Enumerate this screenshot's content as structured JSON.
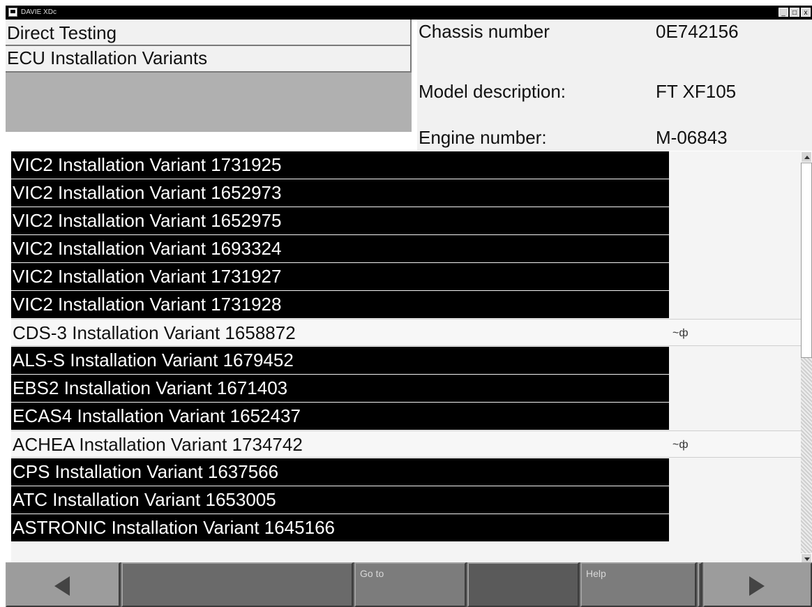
{
  "window": {
    "title": "DAVIE XDc",
    "minimize": "_",
    "maximize": "□",
    "close": "x"
  },
  "header": {
    "direct_testing": "Direct Testing",
    "ecu_installation_variants": "ECU Installation Variants"
  },
  "vehicle": {
    "chassis_label": "Chassis number",
    "chassis_value": "0E742156",
    "model_label": "Model description:",
    "model_value": "FT XF105",
    "engine_label": "Engine number:",
    "engine_value": "M-06843"
  },
  "list": {
    "items": [
      {
        "label": "VIC2 Installation Variant 1731925",
        "selected": true
      },
      {
        "label": "VIC2 Installation Variant 1652973",
        "selected": true
      },
      {
        "label": "VIC2 Installation Variant 1652975",
        "selected": true
      },
      {
        "label": "VIC2 Installation Variant 1693324",
        "selected": true
      },
      {
        "label": "VIC2 Installation Variant 1731927",
        "selected": true
      },
      {
        "label": "VIC2 Installation Variant 1731928",
        "selected": true
      },
      {
        "label": "CDS-3 Installation Variant 1658872",
        "selected": false,
        "flag": "~ф"
      },
      {
        "label": "ALS-S Installation Variant 1679452",
        "selected": true
      },
      {
        "label": "EBS2 Installation Variant 1671403",
        "selected": true
      },
      {
        "label": "ECAS4 Installation Variant 1652437",
        "selected": true
      },
      {
        "label": "ACHEA Installation Variant 1734742",
        "selected": false,
        "flag": "~ф"
      },
      {
        "label": "CPS Installation Variant 1637566",
        "selected": true
      },
      {
        "label": "ATC Installation Variant 1653005",
        "selected": true
      },
      {
        "label": "ASTRONIC Installation Variant 1645166",
        "selected": true
      }
    ]
  },
  "toolbar": {
    "goto_label": "Go to",
    "help_label": "Help"
  },
  "icons": {
    "back": "arrow-left-icon",
    "forward": "arrow-right-icon"
  }
}
